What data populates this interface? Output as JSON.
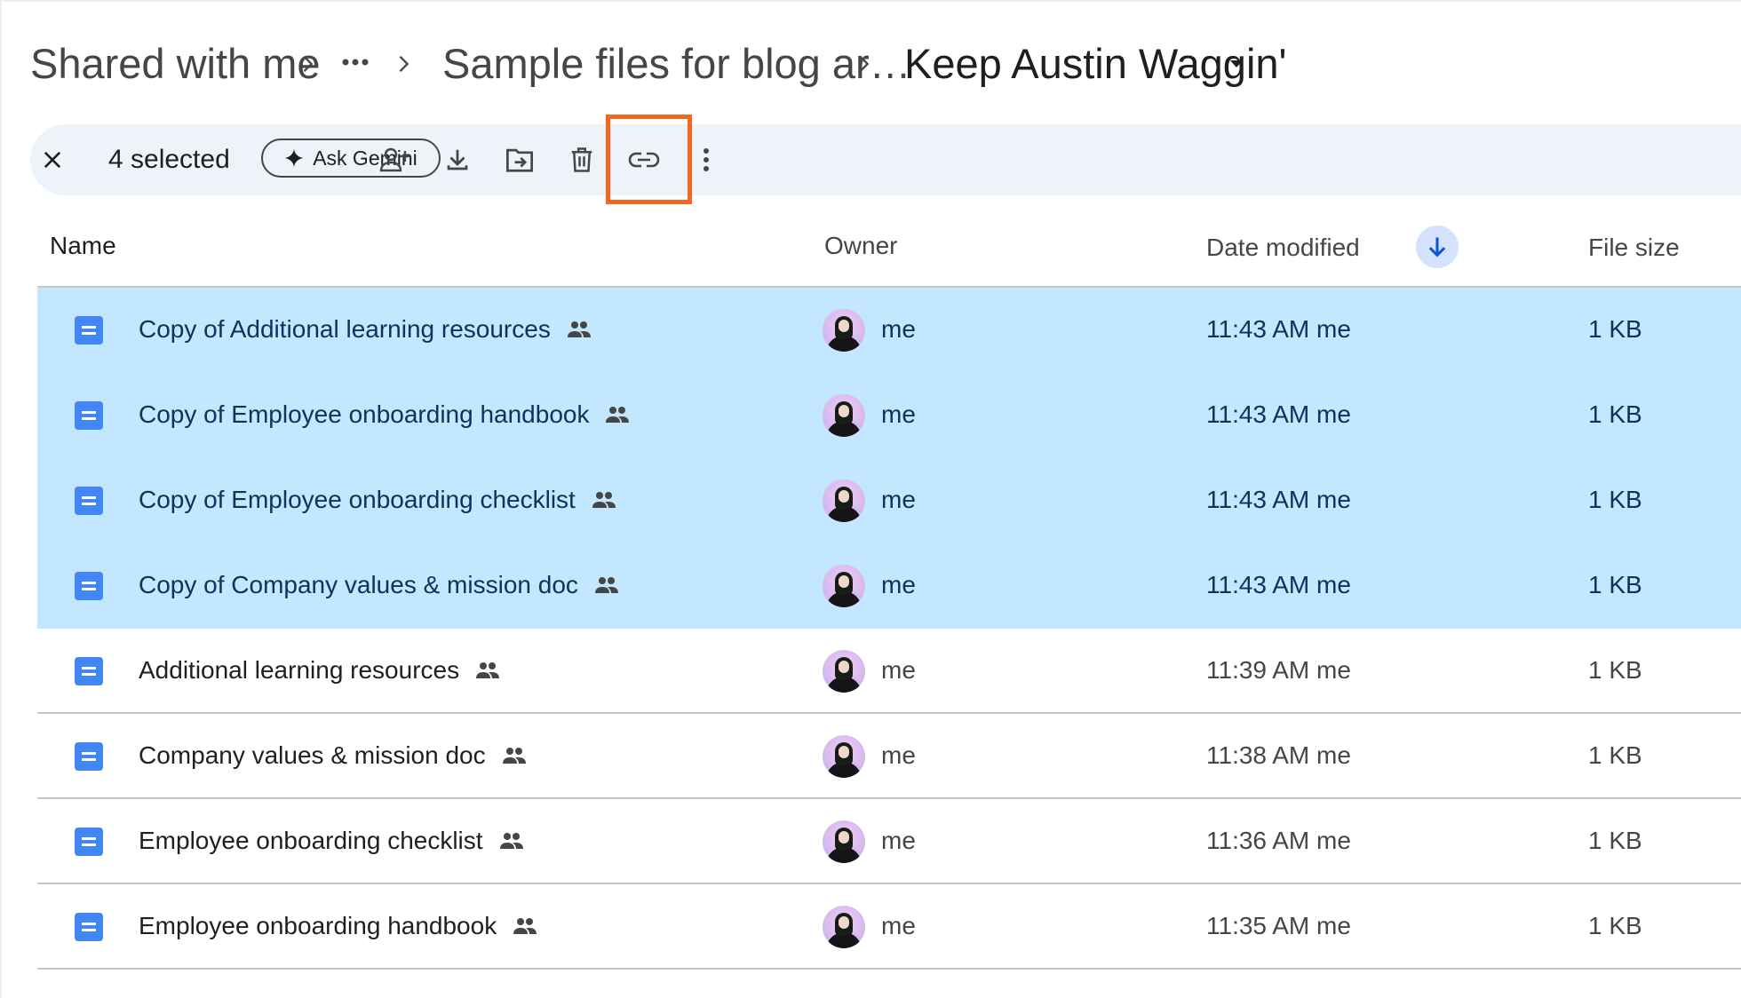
{
  "breadcrumb": {
    "root": "Shared with me",
    "overflow": "…",
    "parent": "Sample files for blog ar…",
    "current": "Keep Austin Waggin'"
  },
  "toolbar": {
    "selected_count": "4 selected",
    "ask_gemini": "Ask Gemini",
    "highlight_color": "#f26722",
    "icons": [
      "close-icon",
      "sparkle-icon",
      "add-person-icon",
      "download-icon",
      "move-to-folder-icon",
      "trash-icon",
      "link-icon",
      "more-vert-icon"
    ]
  },
  "columns": {
    "name": "Name",
    "owner": "Owner",
    "date": "Date modified",
    "size": "File size"
  },
  "files": [
    {
      "name": "Copy of Additional learning resources",
      "owner": "me",
      "modified": "11:43 AM me",
      "size": "1 KB",
      "selected": true
    },
    {
      "name": "Copy of Employee onboarding handbook",
      "owner": "me",
      "modified": "11:43 AM me",
      "size": "1 KB",
      "selected": true
    },
    {
      "name": "Copy of Employee onboarding checklist",
      "owner": "me",
      "modified": "11:43 AM me",
      "size": "1 KB",
      "selected": true
    },
    {
      "name": "Copy of Company values & mission doc",
      "owner": "me",
      "modified": "11:43 AM me",
      "size": "1 KB",
      "selected": true
    },
    {
      "name": "Additional learning resources",
      "owner": "me",
      "modified": "11:39 AM me",
      "size": "1 KB",
      "selected": false
    },
    {
      "name": "Company values & mission doc",
      "owner": "me",
      "modified": "11:38 AM me",
      "size": "1 KB",
      "selected": false
    },
    {
      "name": "Employee onboarding checklist",
      "owner": "me",
      "modified": "11:36 AM me",
      "size": "1 KB",
      "selected": false
    },
    {
      "name": "Employee onboarding handbook",
      "owner": "me",
      "modified": "11:35 AM me",
      "size": "1 KB",
      "selected": false
    }
  ],
  "colors": {
    "selected_row": "#c2e7ff",
    "toolbar_bg": "#eef2f9",
    "doc_icon": "#4285f4",
    "sort_badge": "#d3e3fd"
  }
}
